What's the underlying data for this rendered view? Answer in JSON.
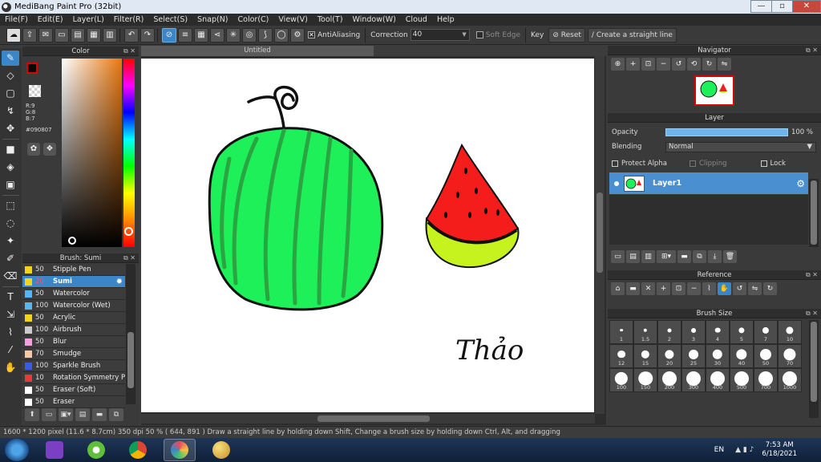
{
  "window": {
    "title": "MediBang Paint Pro (32bit)",
    "min": "—",
    "max": "▫",
    "close": "✕"
  },
  "menu": [
    "File(F)",
    "Edit(E)",
    "Layer(L)",
    "Filter(R)",
    "Select(S)",
    "Snap(N)",
    "Color(C)",
    "View(V)",
    "Tool(T)",
    "Window(W)",
    "Cloud",
    "Help"
  ],
  "toolbar": {
    "antialiasing_label": "AntiAliasing",
    "correction_label": "Correction",
    "correction_value": "40",
    "soft_edge_label": "Soft Edge",
    "key_label": "Key",
    "reset_label": "Reset",
    "straight_line_label": "Create a straight line"
  },
  "color_panel": {
    "title": "Color",
    "r": "R:9",
    "g": "G:8",
    "b": "B:7",
    "hex": "#090807",
    "fg_color": "#090807"
  },
  "brush_panel": {
    "title": "Brush: Sumi",
    "brushes": [
      {
        "size": "50",
        "name": "Stipple Pen",
        "color": "#f2d41a"
      },
      {
        "size": "20",
        "name": "Sumi",
        "color": "#f2d41a"
      },
      {
        "size": "50",
        "name": "Watercolor",
        "color": "#5ab4f0"
      },
      {
        "size": "100",
        "name": "Watercolor (Wet)",
        "color": "#5ab4f0"
      },
      {
        "size": "50",
        "name": "Acrylic",
        "color": "#f2d41a"
      },
      {
        "size": "100",
        "name": "Airbrush",
        "color": "#cccccc"
      },
      {
        "size": "50",
        "name": "Blur",
        "color": "#f4a0e0"
      },
      {
        "size": "70",
        "name": "Smudge",
        "color": "#f6c8a8"
      },
      {
        "size": "100",
        "name": "Sparkle Brush",
        "color": "#3a5ae8"
      },
      {
        "size": "10",
        "name": "Rotation Symmetry P",
        "color": "#e83a3a"
      },
      {
        "size": "50",
        "name": "Eraser (Soft)",
        "color": "#ffffff"
      },
      {
        "size": "50",
        "name": "Eraser",
        "color": "#ffffff"
      }
    ]
  },
  "document": {
    "tab": "Untitled",
    "signature": "Thảo"
  },
  "navigator": {
    "title": "Navigator"
  },
  "layer_panel": {
    "title": "Layer",
    "opacity_label": "Opacity",
    "opacity_value": "100 %",
    "opacity": 1.0,
    "blending_label": "Blending",
    "blending_value": "Normal",
    "protect_alpha": "Protect Alpha",
    "clipping": "Clipping",
    "lock": "Lock",
    "layer_name": "Layer1"
  },
  "reference": {
    "title": "Reference"
  },
  "brush_size": {
    "title": "Brush Size",
    "sizes": [
      "1",
      "1.5",
      "2",
      "3",
      "4",
      "5",
      "7",
      "10",
      "12",
      "15",
      "20",
      "25",
      "30",
      "40",
      "50",
      "70",
      "100",
      "150",
      "200",
      "300",
      "400",
      "500",
      "700",
      "1000"
    ]
  },
  "status": {
    "text": "1600 * 1200 pixel   (11.6 * 8.7cm)   350 dpi   50 %   ( 644, 891 )   Draw a straight line by holding down Shift, Change a brush size by holding down Ctrl, Alt, and dragging"
  },
  "taskbar": {
    "lang": "EN",
    "time": "7:53 AM",
    "date": "6/18/2021"
  },
  "colors": {
    "accent": "#3a86c8",
    "watermelon_green": "#1ef05a",
    "watermelon_red": "#f51c1c",
    "rind": "#c6f21e"
  }
}
